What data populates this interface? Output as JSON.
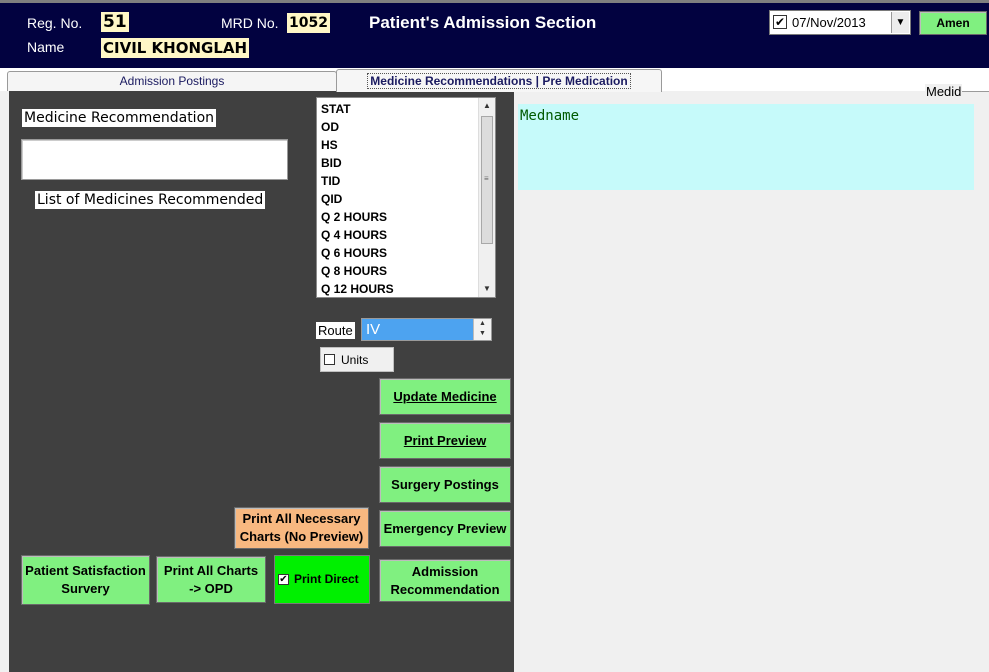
{
  "header": {
    "reg_no_label": "Reg. No.",
    "reg_no_value": "51",
    "mrd_no_label": "MRD No.",
    "mrd_no_value": "1052",
    "name_label": "Name",
    "name_value": "CIVIL KHONGLAH",
    "section_title": "Patient's Admission Section",
    "date_value": "07/Nov/2013",
    "date_checked": true,
    "amen_label": "Amen"
  },
  "tabs": [
    {
      "label": "Admission Postings",
      "active": false
    },
    {
      "label": "Medicine Recommendations | Pre Medication",
      "active": true
    }
  ],
  "left": {
    "medicine_recommendation_label": "Medicine Recommendation",
    "medicine_recommendation_value": "",
    "list_label": "List of Medicines Recommended",
    "frequency_options": [
      "STAT",
      "OD",
      "HS",
      "BID",
      "TID",
      "QID",
      "Q 2 HOURS",
      "Q 4 HOURS",
      "Q 6 HOURS",
      "Q 8 HOURS",
      "Q 12 HOURS"
    ],
    "route_label": "Route",
    "route_value": "IV",
    "units_label": "Units",
    "units_checked": false
  },
  "buttons": {
    "update_medicine": "Update Medicine",
    "print_preview": "Print Preview",
    "surgery_postings": "Surgery Postings",
    "emergency_preview": "Emergency Preview",
    "admission_recommendation_line1": "Admission",
    "admission_recommendation_line2": "Recommendation",
    "print_all_necessary_line1": "Print All Necessary",
    "print_all_necessary_line2": "Charts (No Preview)",
    "patient_satisfaction_line1": "Patient Satisfaction",
    "patient_satisfaction_line2": "Survery",
    "print_all_charts_line1": "Print All Charts",
    "print_all_charts_line2": "-> OPD",
    "print_direct_label": "Print Direct",
    "print_direct_checked": true
  },
  "right": {
    "medid_label": "Medid",
    "medname_label": "Medname"
  },
  "colors": {
    "header_bg": "#020240",
    "button_green": "#80f080",
    "button_orange": "#f8b880",
    "print_direct_green": "#00f000",
    "medname_bg": "#c6fafa",
    "route_highlight": "#4da3f0"
  }
}
